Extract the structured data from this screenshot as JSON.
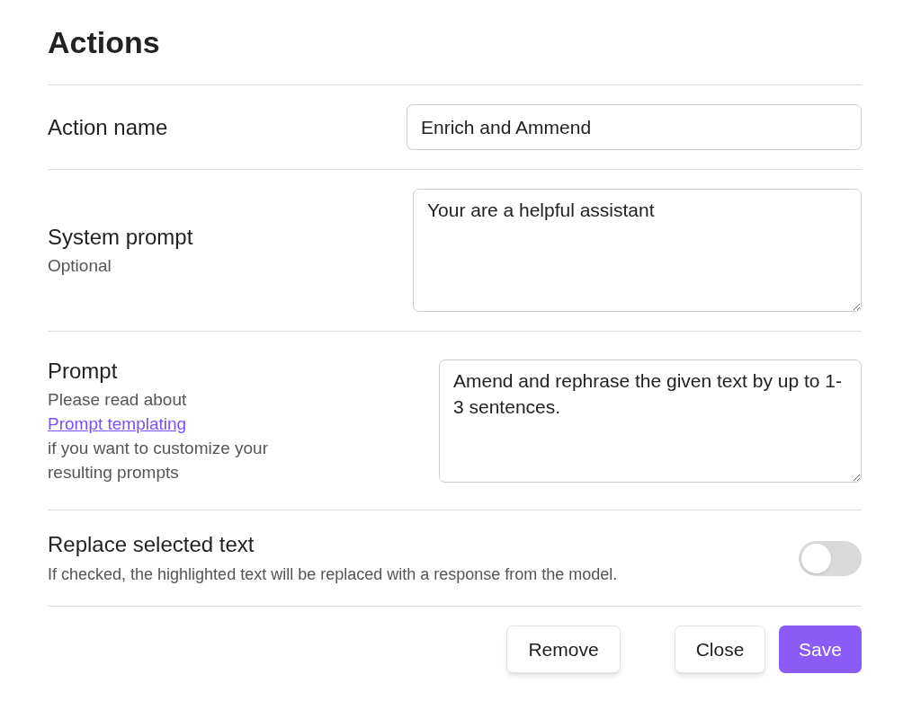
{
  "title": "Actions",
  "fields": [
    {
      "kind": "input",
      "label": "Action name",
      "value": "Enrich and Ammend"
    },
    {
      "kind": "textarea",
      "label": "System prompt",
      "description": "Optional",
      "value": "Your are a helpful assistant"
    },
    {
      "kind": "textarea",
      "label": "Prompt",
      "description": "Please read about",
      "link": "Prompt templating",
      "description_after": "if you want to customize your resulting prompts",
      "value": "Amend and rephrase the given text by up to 1-3 sentences."
    }
  ],
  "toggle": {
    "label": "Replace selected text",
    "description": "If checked, the highlighted text will be replaced with a response from the model.",
    "on": false
  },
  "buttons": [
    {
      "kind": "secondary",
      "label": "Remove"
    },
    {
      "kind": "secondary",
      "label": "Close"
    },
    {
      "kind": "primary",
      "label": "Save"
    }
  ]
}
